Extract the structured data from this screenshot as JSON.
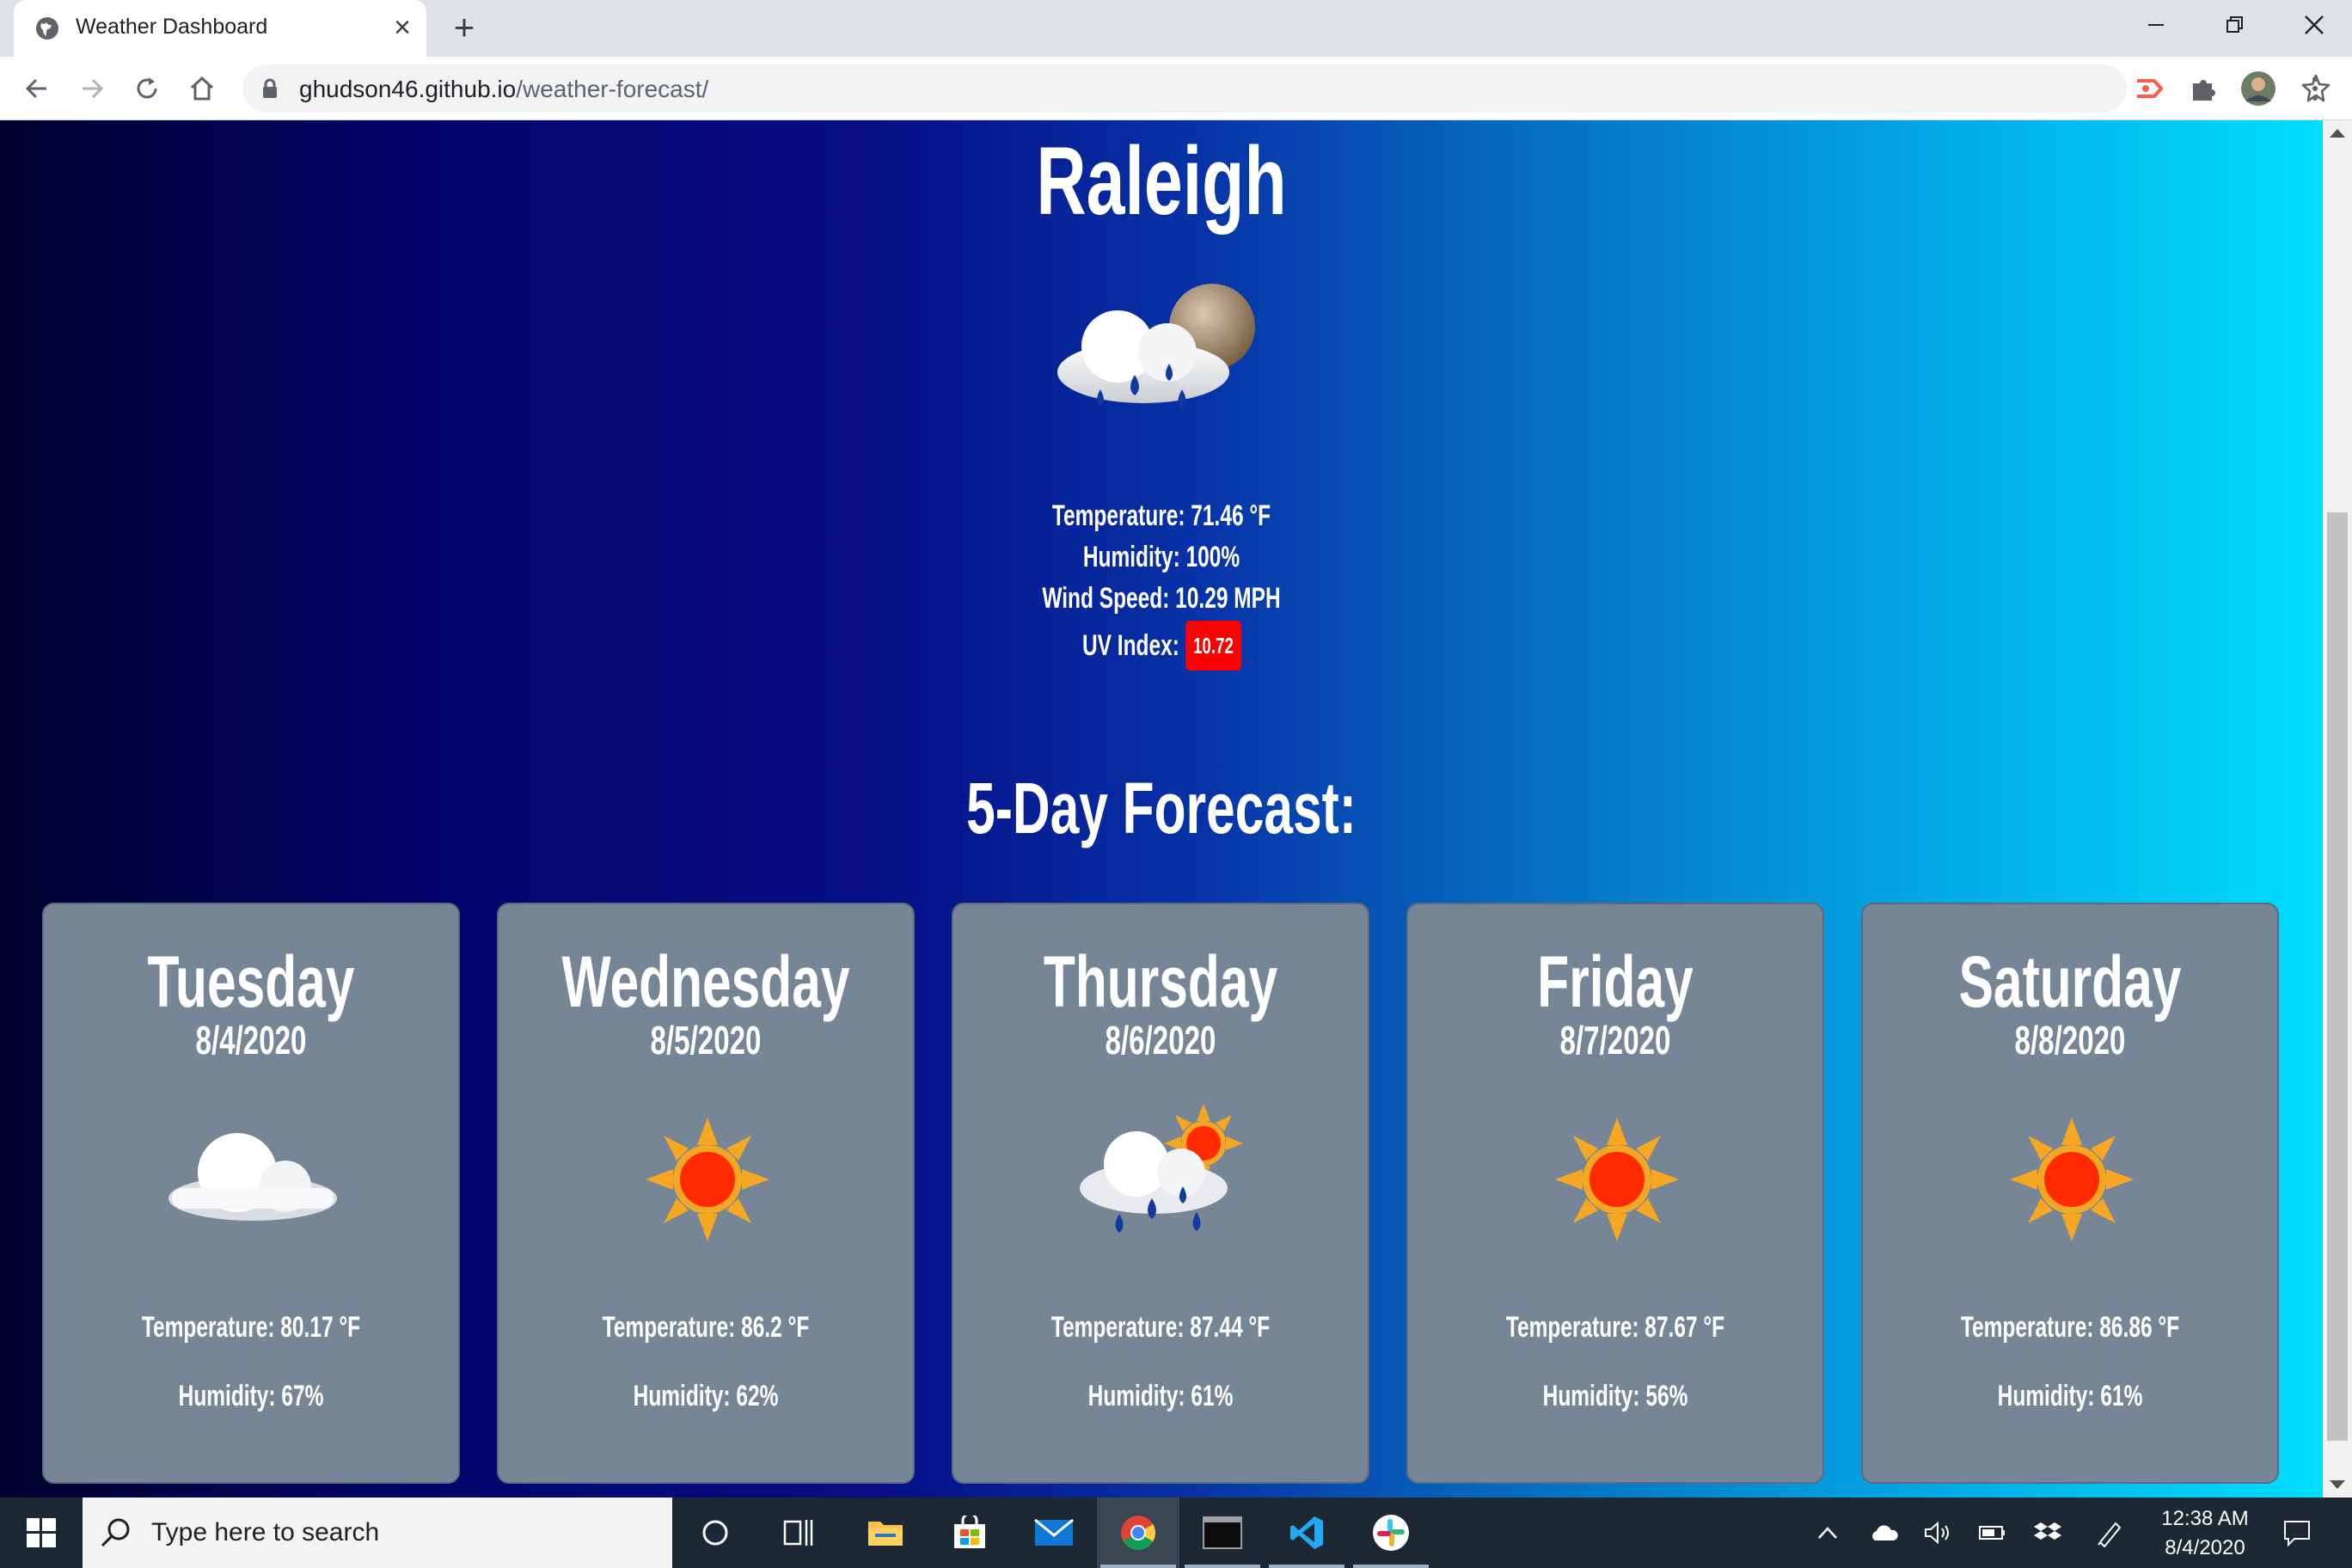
{
  "browser": {
    "tab_title": "Weather Dashboard",
    "url_domain": "ghudson46.github.io",
    "url_path": "/weather-forecast/"
  },
  "current": {
    "city": "Raleigh",
    "icon": "rain-cloud-moon-icon",
    "temperature": "Temperature: 71.46 °F",
    "humidity": "Humidity: 100%",
    "wind": "Wind Speed: 10.29 MPH",
    "uv_label": "UV Index:",
    "uv_value": "10.72",
    "uv_color": "#ff0000"
  },
  "forecast_title": "5-Day Forecast:",
  "forecast": [
    {
      "day": "Tuesday",
      "date": "8/4/2020",
      "icon": "cloud-icon",
      "temp": "Temperature: 80.17 °F",
      "humidity": "Humidity: 67%"
    },
    {
      "day": "Wednesday",
      "date": "8/5/2020",
      "icon": "sun-icon",
      "temp": "Temperature: 86.2 °F",
      "humidity": "Humidity: 62%"
    },
    {
      "day": "Thursday",
      "date": "8/6/2020",
      "icon": "rain-cloud-sun-icon",
      "temp": "Temperature: 87.44 °F",
      "humidity": "Humidity: 61%"
    },
    {
      "day": "Friday",
      "date": "8/7/2020",
      "icon": "sun-icon",
      "temp": "Temperature: 87.67 °F",
      "humidity": "Humidity: 56%"
    },
    {
      "day": "Saturday",
      "date": "8/8/2020",
      "icon": "sun-icon",
      "temp": "Temperature: 86.86 °F",
      "humidity": "Humidity: 61%"
    }
  ],
  "taskbar": {
    "search_placeholder": "Type here to search",
    "time": "12:38 AM",
    "date": "8/4/2020"
  },
  "colors": {
    "card_bg": "#768696",
    "uv_high": "#ff0000",
    "taskbar": "#1c2833"
  }
}
